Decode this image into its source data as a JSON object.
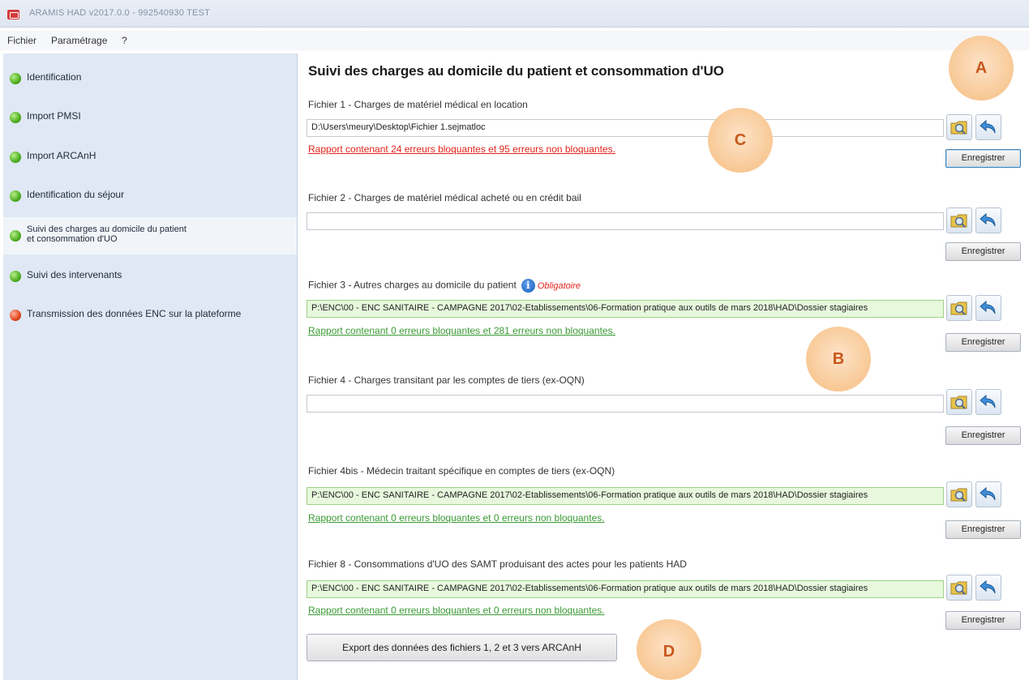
{
  "window": {
    "title": "ARAMIS HAD v2017.0.0  -  992540930  TEST"
  },
  "menu": {
    "items": [
      "Fichier",
      "Paramétrage",
      "?"
    ]
  },
  "sidebar": {
    "items": [
      {
        "label": "Identification",
        "status": "green"
      },
      {
        "label": "Import PMSI",
        "status": "green"
      },
      {
        "label": "Import ARCAnH",
        "status": "green"
      },
      {
        "label": "Identification du séjour",
        "status": "green"
      },
      {
        "label": "Suivi des charges au domicile du patient\net consommation d'UO",
        "status": "green",
        "selected": true
      },
      {
        "label": "Suivi des intervenants",
        "status": "green"
      },
      {
        "label": "Transmission des données ENC sur la plateforme",
        "status": "red"
      }
    ]
  },
  "main": {
    "title": "Suivi des charges au domicile du patient et consommation d'UO",
    "files": [
      {
        "label": "Fichier 1 - Charges de matériel médical en location",
        "path": "D:\\Users\\meury\\Desktop\\Fichier 1.sejmatloc",
        "report": "Rapport contenant 24 erreurs bloquantes et 95 erreurs non bloquantes.",
        "report_status": "error",
        "save_label": "Enregistrer"
      },
      {
        "label": "Fichier 2 - Charges de matériel médical acheté ou en crédit bail",
        "path": "",
        "report": "",
        "save_label": "Enregistrer"
      },
      {
        "label": "Fichier 3 - Autres charges au domicile du patient",
        "required_label": "Obligatoire",
        "path": "P:\\ENC\\00 - ENC SANITAIRE - CAMPAGNE 2017\\02-Etablissements\\06-Formation pratique aux outils de mars 2018\\HAD\\Dossier stagiaires",
        "report": "Rapport contenant 0 erreurs bloquantes et 281 erreurs non bloquantes.",
        "report_status": "ok",
        "save_label": "Enregistrer"
      },
      {
        "label": "Fichier 4 - Charges transitant par les comptes de tiers (ex-OQN)",
        "path": "",
        "report": "",
        "save_label": "Enregistrer"
      },
      {
        "label": "Fichier 4bis - Médecin traitant spécifique en comptes de tiers (ex-OQN)",
        "path": "P:\\ENC\\00 - ENC SANITAIRE - CAMPAGNE 2017\\02-Etablissements\\06-Formation pratique aux outils de mars 2018\\HAD\\Dossier stagiaires",
        "report": "Rapport contenant 0 erreurs bloquantes et 0 erreurs non bloquantes.",
        "report_status": "ok",
        "save_label": "Enregistrer"
      },
      {
        "label": "Fichier 8 - Consommations d'UO des SAMT produisant des actes pour les patients HAD",
        "path": "P:\\ENC\\00 - ENC SANITAIRE - CAMPAGNE 2017\\02-Etablissements\\06-Formation pratique aux outils de mars 2018\\HAD\\Dossier stagiaires",
        "report": "Rapport contenant 0 erreurs bloquantes et 0 erreurs non bloquantes.",
        "report_status": "ok",
        "save_label": "Enregistrer"
      }
    ],
    "export_label": "Export des données des fichiers 1, 2 et 3 vers ARCAnH"
  },
  "callouts": [
    "A",
    "B",
    "C",
    "D"
  ],
  "icons": {
    "browse": "folder-magnifier-icon",
    "undo": "undo-arrow-icon",
    "info": "info-icon"
  },
  "colors": {
    "error_text": "#e2231a",
    "ok_text": "#3a9a34",
    "valid_field": "#e7f8dd",
    "callout_fill": "#f8c895",
    "callout_text": "#c8581c"
  }
}
